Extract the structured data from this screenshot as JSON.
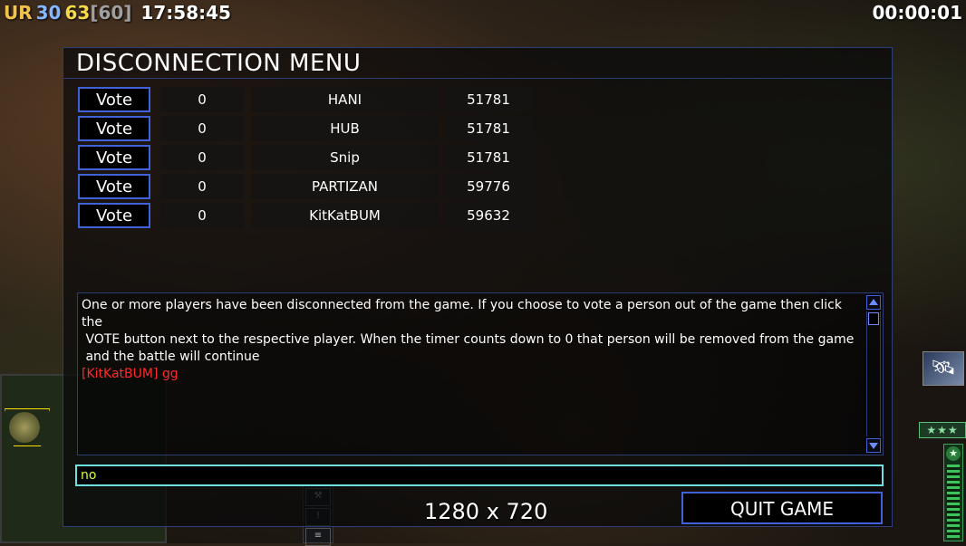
{
  "hud": {
    "faction": "UR",
    "value_blue": "30",
    "value_yellow": "63",
    "value_bracket": "[60]",
    "clock": "17:58:45",
    "game_timer": "00:00:01"
  },
  "dialog": {
    "title": "DISCONNECTION MENU",
    "players": [
      {
        "vote_label": "Vote",
        "votes": "0",
        "name": "HANI",
        "port": "51781"
      },
      {
        "vote_label": "Vote",
        "votes": "0",
        "name": "HUB",
        "port": "51781"
      },
      {
        "vote_label": "Vote",
        "votes": "0",
        "name": "Snip",
        "port": "51781"
      },
      {
        "vote_label": "Vote",
        "votes": "0",
        "name": "PARTIZAN",
        "port": "59776"
      },
      {
        "vote_label": "Vote",
        "votes": "0",
        "name": "KitKatBUM",
        "port": "59632"
      }
    ],
    "message": {
      "line1": "One or more players have been disconnected from the game. If you choose to vote a person out of the game then click the",
      "line2": " VOTE button next to the respective player. When the timer counts down to 0 that person will be removed from the game",
      "line3": " and the battle will continue",
      "chat": "[KitKatBUM] gg"
    },
    "chat_input_value": "no",
    "resolution": "1280 x 720",
    "quit_label": "QUIT GAME"
  },
  "side_hud": {
    "rank_stars": "★★★",
    "satellite_icon": "satellite-icon",
    "badge_icon": "star-badge-icon"
  },
  "colors": {
    "accent_border": "#3f62d8",
    "chat_text": "#ff2a2a",
    "input_text": "#d2ff3a",
    "input_border": "#6fe0e0"
  }
}
